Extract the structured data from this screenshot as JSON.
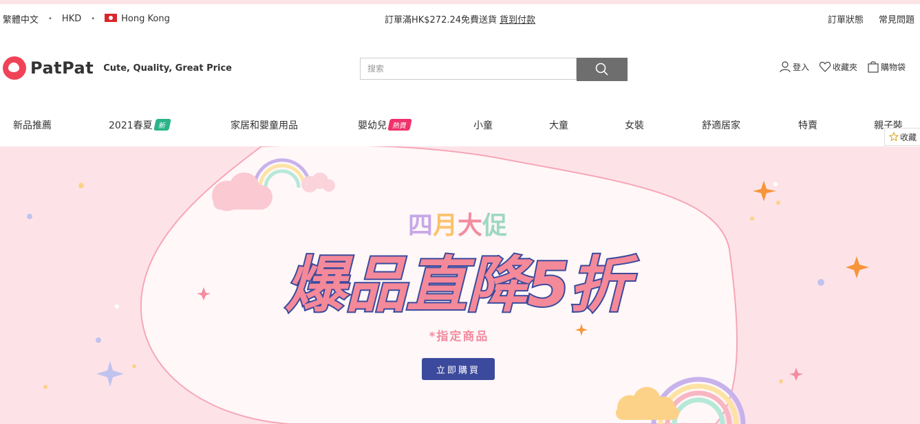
{
  "topbar": {
    "language": "繁體中文",
    "currency": "HKD",
    "region": "Hong Kong",
    "promo_text": "訂單滿HK$272.24免費送貨",
    "promo_link": "貨到付款",
    "order_status": "訂單狀態",
    "faq": "常見問題"
  },
  "header": {
    "brand": "PatPat",
    "tagline": "Cute, Quality, Great Price",
    "search_placeholder": "搜索",
    "login": "登入",
    "wishlist": "收藏夾",
    "cart": "購物袋"
  },
  "nav": {
    "items": [
      {
        "label": "新品推薦"
      },
      {
        "label": "2021春夏",
        "tag": "新",
        "tag_color": "#2bb38a"
      },
      {
        "label": "家居和嬰童用品"
      },
      {
        "label": "嬰幼兒",
        "tag": "熱賣",
        "tag_color": "#f0326c"
      },
      {
        "label": "小童"
      },
      {
        "label": "大童"
      },
      {
        "label": "女裝"
      },
      {
        "label": "舒適居家"
      },
      {
        "label": "特賣"
      },
      {
        "label": "親子裝"
      }
    ],
    "favorite_float": "收藏"
  },
  "banner": {
    "kicker": "四月大促",
    "headline": "爆品直降5折",
    "note": "*指定商品",
    "cta": "立即購買",
    "colors": {
      "bg": "#fde3e8",
      "headline_fill": "#f4899a",
      "headline_stroke": "#3b4a9c",
      "cta_bg": "#3b4a9c"
    }
  }
}
